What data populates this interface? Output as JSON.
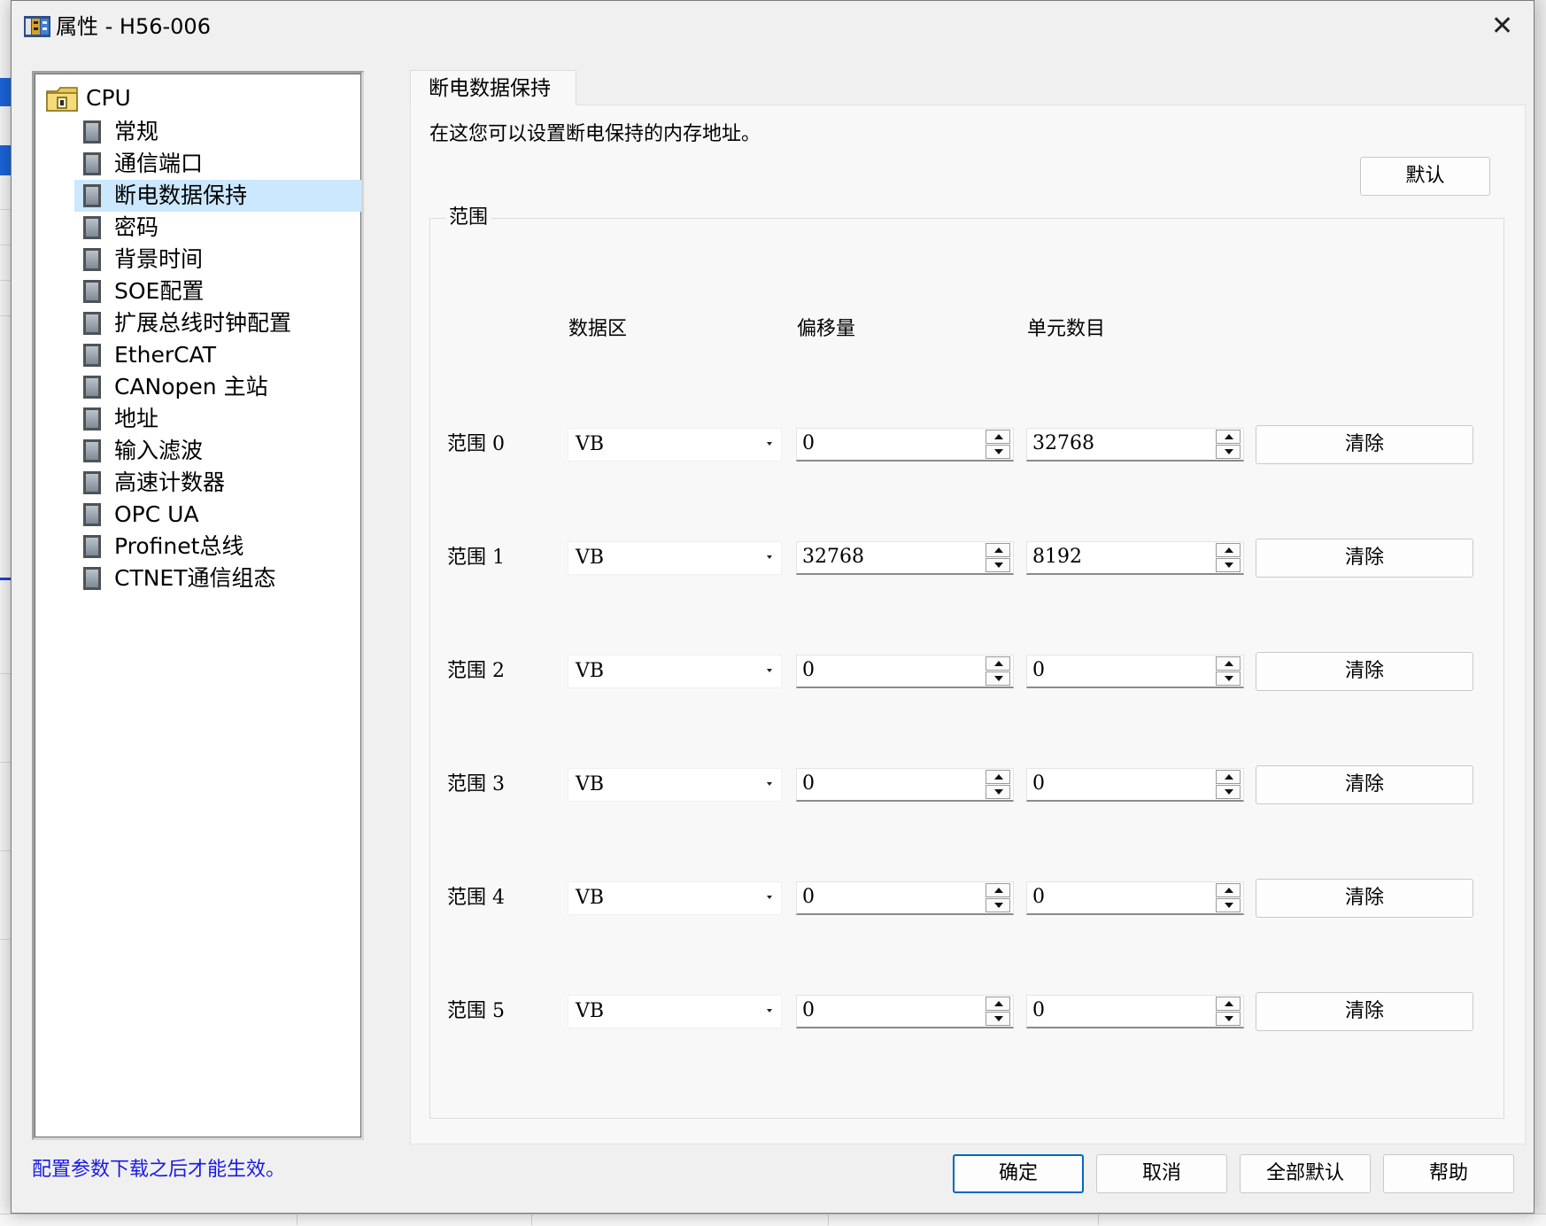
{
  "window": {
    "title": "属性 - H56-006"
  },
  "tree": {
    "root_label": "CPU",
    "items": [
      {
        "label": "常规"
      },
      {
        "label": "通信端口"
      },
      {
        "label": "断电数据保持"
      },
      {
        "label": "密码"
      },
      {
        "label": "背景时间"
      },
      {
        "label": "SOE配置"
      },
      {
        "label": "扩展总线时钟配置"
      },
      {
        "label": "EtherCAT"
      },
      {
        "label": "CANopen 主站"
      },
      {
        "label": "地址"
      },
      {
        "label": "输入滤波"
      },
      {
        "label": "高速计数器"
      },
      {
        "label": "OPC UA"
      },
      {
        "label": "Profinet总线"
      },
      {
        "label": "CTNET通信组态"
      }
    ],
    "selected_index": 2
  },
  "tab": {
    "label": "断电数据保持"
  },
  "panel": {
    "description": "在这您可以设置断电保持的内存地址。",
    "default_button": "默认",
    "group_label": "范围",
    "columns": {
      "data_area": "数据区",
      "offset": "偏移量",
      "count": "单元数目"
    },
    "rows": [
      {
        "label": "范围 0",
        "area": "VB",
        "offset": "0",
        "count": "32768",
        "clear": "清除"
      },
      {
        "label": "范围 1",
        "area": "VB",
        "offset": "32768",
        "count": "8192",
        "clear": "清除"
      },
      {
        "label": "范围 2",
        "area": "VB",
        "offset": "0",
        "count": "0",
        "clear": "清除"
      },
      {
        "label": "范围 3",
        "area": "VB",
        "offset": "0",
        "count": "0",
        "clear": "清除"
      },
      {
        "label": "范围 4",
        "area": "VB",
        "offset": "0",
        "count": "0",
        "clear": "清除"
      },
      {
        "label": "范围 5",
        "area": "VB",
        "offset": "0",
        "count": "0",
        "clear": "清除"
      }
    ]
  },
  "footer": {
    "note": "配置参数下载之后才能生效。",
    "ok": "确定",
    "cancel": "取消",
    "all_default": "全部默认",
    "help": "帮助"
  },
  "colors": {
    "selection": "#cce8ff",
    "note_text": "#1a1ae6",
    "primary_border": "#0067c0"
  }
}
